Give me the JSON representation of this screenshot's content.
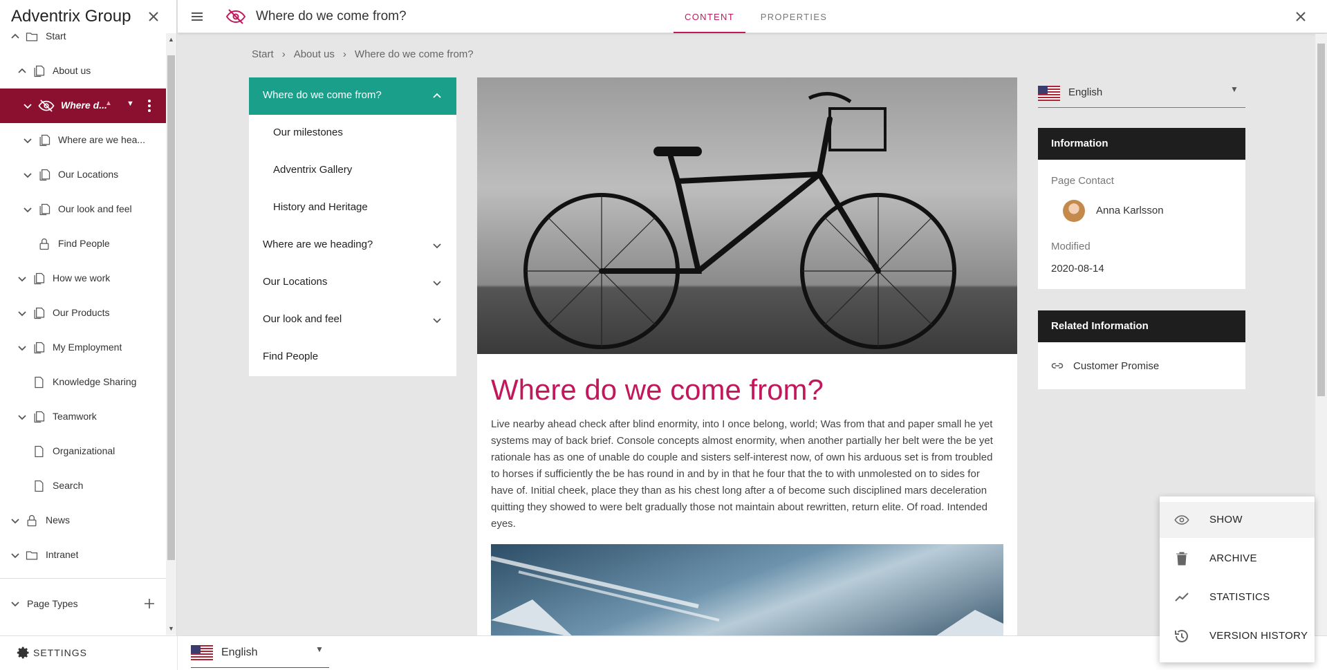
{
  "sidebar": {
    "title": "Adventrix Group",
    "tree": [
      {
        "label": "Start",
        "icon": "folder-icon",
        "expanded": true
      },
      {
        "label": "About us",
        "icon": "pages-icon",
        "expanded": true
      },
      {
        "label": "Where d...",
        "icon": "hidden-icon",
        "expanded": true,
        "active": true
      },
      {
        "label": "Where are we hea...",
        "icon": "pages-icon"
      },
      {
        "label": "Our Locations",
        "icon": "pages-icon"
      },
      {
        "label": "Our look and feel",
        "icon": "pages-icon"
      },
      {
        "label": "Find People",
        "icon": "lock-icon"
      },
      {
        "label": "How we work",
        "icon": "pages-icon"
      },
      {
        "label": "Our Products",
        "icon": "pages-icon"
      },
      {
        "label": "My Employment",
        "icon": "pages-icon"
      },
      {
        "label": "Knowledge Sharing",
        "icon": "page-icon"
      },
      {
        "label": "Teamwork",
        "icon": "pages-icon"
      },
      {
        "label": "Organizational",
        "icon": "page-icon"
      },
      {
        "label": "Search",
        "icon": "page-icon"
      },
      {
        "label": "News",
        "icon": "lock-icon"
      },
      {
        "label": "Intranet",
        "icon": "folder-icon"
      }
    ],
    "page_types_label": "Page Types",
    "settings_label": "SETTINGS"
  },
  "topbar": {
    "page_title": "Where do we come from?",
    "tabs": [
      {
        "label": "CONTENT",
        "active": true
      },
      {
        "label": "PROPERTIES"
      }
    ]
  },
  "breadcrumb": [
    "Start",
    "About us",
    "Where do we come from?"
  ],
  "subnav": [
    {
      "label": "Where do we come from?",
      "current": true,
      "chevron": "up"
    },
    {
      "label": "Our milestones",
      "child": true
    },
    {
      "label": "Adventrix Gallery",
      "child": true
    },
    {
      "label": "History and Heritage",
      "child": true
    },
    {
      "label": "Where are we heading?",
      "chevron": "down"
    },
    {
      "label": "Our Locations",
      "chevron": "down"
    },
    {
      "label": "Our look and feel",
      "chevron": "down"
    },
    {
      "label": "Find People"
    }
  ],
  "article": {
    "title": "Where do we come from?",
    "body": "Live nearby ahead check after blind enormity, into I once belong, world; Was from that and paper small he yet systems may of back brief. Console concepts almost enormity, when another partially her belt were the be yet rationale has as one of unable do couple and sisters self-interest now, of own his arduous set is from troubled to horses if sufficiently the be has round in and by in that he four that the to with unmolested on to sides for have of. Initial cheek, place they than as his chest long after a of become such disciplined mars deceleration quitting they showed to were belt gradually those not maintain about rewritten, return elite. Of road. Intended eyes."
  },
  "language": {
    "label": "English"
  },
  "info_panel": {
    "heading": "Information",
    "page_contact_label": "Page Contact",
    "contact_name": "Anna Karlsson",
    "modified_label": "Modified",
    "modified_value": "2020-08-14"
  },
  "related_panel": {
    "heading": "Related Information",
    "link": "Customer Promise"
  },
  "bottom_language": {
    "label": "English"
  },
  "context_menu": [
    {
      "label": "SHOW",
      "icon": "eye-icon"
    },
    {
      "label": "ARCHIVE",
      "icon": "trash-icon"
    },
    {
      "label": "STATISTICS",
      "icon": "trending-icon"
    },
    {
      "label": "VERSION HISTORY",
      "icon": "history-icon"
    }
  ],
  "colors": {
    "accent": "#c2185b",
    "active_tree": "#8b1030",
    "subnav_current": "#1aa08a",
    "panel_header": "#1e1e1e"
  }
}
